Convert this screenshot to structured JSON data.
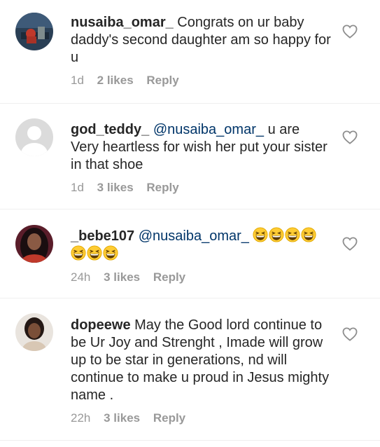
{
  "comments": [
    {
      "username": "nusaiba_omar_",
      "mention": "",
      "text": "Congrats on ur baby daddy's second daughter am so happy for u",
      "time": "1d",
      "likes": "2 likes",
      "reply": "Reply"
    },
    {
      "username": "god_teddy_",
      "mention": "@nusaiba_omar_",
      "text": "u are Very heartless for wish her put your sister in that shoe",
      "time": "1d",
      "likes": "3 likes",
      "reply": "Reply"
    },
    {
      "username": "_bebe107",
      "mention": "@nusaiba_omar_",
      "text": "",
      "emoji_name": "grinning-squinting-face",
      "emoji_count": 7,
      "time": "24h",
      "likes": "3 likes",
      "reply": "Reply"
    },
    {
      "username": "dopeewe",
      "mention": "",
      "text": "May the Good lord continue to be Ur Joy and Strenght , Imade will grow up to be star in generations, nd will continue to make u proud in Jesus mighty name .",
      "time": "22h",
      "likes": "3 likes",
      "reply": "Reply"
    }
  ],
  "icons": {
    "like": "heart-outline-icon"
  },
  "colors": {
    "username": "#262626",
    "meta": "#999999",
    "mention": "#003569",
    "divider": "#efefef"
  }
}
